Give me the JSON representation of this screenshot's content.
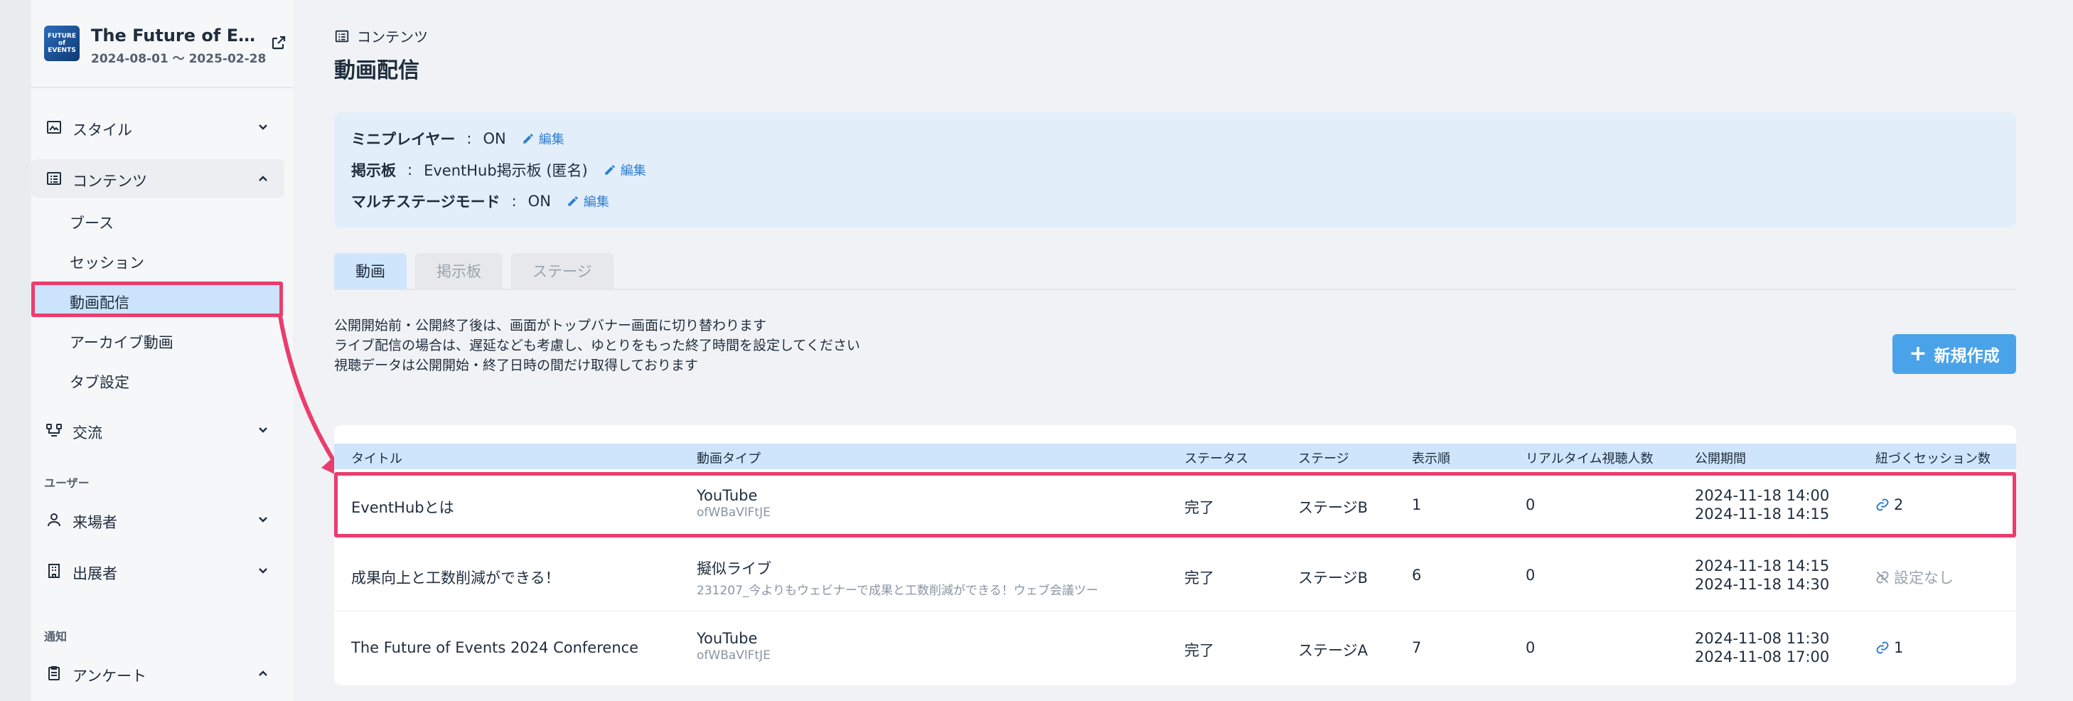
{
  "sidebar": {
    "brand": {
      "logo_text": "FUTURE of EVENTS",
      "title": "The Future of Eve…",
      "period": "2024-08-01 ～ 2025-02-28"
    },
    "items": {
      "style": "スタイル",
      "contents": "コンテンツ",
      "booth": "ブース",
      "session": "セッション",
      "video": "動画配信",
      "archive": "アーカイブ動画",
      "tabs": "タブ設定",
      "exchange": "交流",
      "visitors": "来場者",
      "exhibitors": "出展者",
      "survey": "アンケート"
    },
    "sections": {
      "users": "ユーザー",
      "notifications": "通知"
    }
  },
  "header": {
    "breadcrumb": "コンテンツ",
    "title": "動画配信"
  },
  "settings": {
    "edit_label": "編集",
    "rows": [
      {
        "key": "ミニプレイヤー",
        "value": "ON"
      },
      {
        "key": "掲示板",
        "value": "EventHub掲示板 (匿名)"
      },
      {
        "key": "マルチステージモード",
        "value": "ON"
      }
    ]
  },
  "tabs": [
    "動画",
    "掲示板",
    "ステージ"
  ],
  "notes": [
    "公開開始前・公開終了後は、画面がトップバナー画面に切り替わります",
    "ライブ配信の場合は、遅延なども考慮し、ゆとりをもった終了時間を設定してください",
    "視聴データは公開開始・終了日時の間だけ取得しております"
  ],
  "new_button": "新規作成",
  "table": {
    "headers": [
      "タイトル",
      "動画タイプ",
      "ステータス",
      "ステージ",
      "表示順",
      "リアルタイム視聴人数",
      "公開期間",
      "紐づくセッション数"
    ],
    "rows": [
      {
        "title": "EventHubとは",
        "type": "YouTube",
        "type_sub": "ofWBaVlFtJE",
        "status": "完了",
        "stage": "ステージB",
        "order": "1",
        "viewers": "0",
        "start": "2024-11-18 14:00",
        "end": "2024-11-18 14:15",
        "sessions": "2"
      },
      {
        "title": "成果向上と工数削減ができる！",
        "type": "擬似ライブ",
        "type_sub": "231207_今よりもウェビナーで成果と工数削減ができる！ウェブ会議ツー",
        "status": "完了",
        "stage": "ステージB",
        "order": "6",
        "viewers": "0",
        "start": "2024-11-18 14:15",
        "end": "2024-11-18 14:30",
        "sessions": "設定なし"
      },
      {
        "title": "The Future of Events 2024 Conference",
        "type": "YouTube",
        "type_sub": "ofWBaVlFtJE",
        "status": "完了",
        "stage": "ステージA",
        "order": "7",
        "viewers": "0",
        "start": "2024-11-08 11:30",
        "end": "2024-11-08 17:00",
        "sessions": "1"
      }
    ]
  },
  "colors": {
    "accent": "#4aa3e8",
    "link": "#2f7fd0",
    "highlight_border": "#ea3d6e",
    "selected_bg": "#cce4fb"
  }
}
